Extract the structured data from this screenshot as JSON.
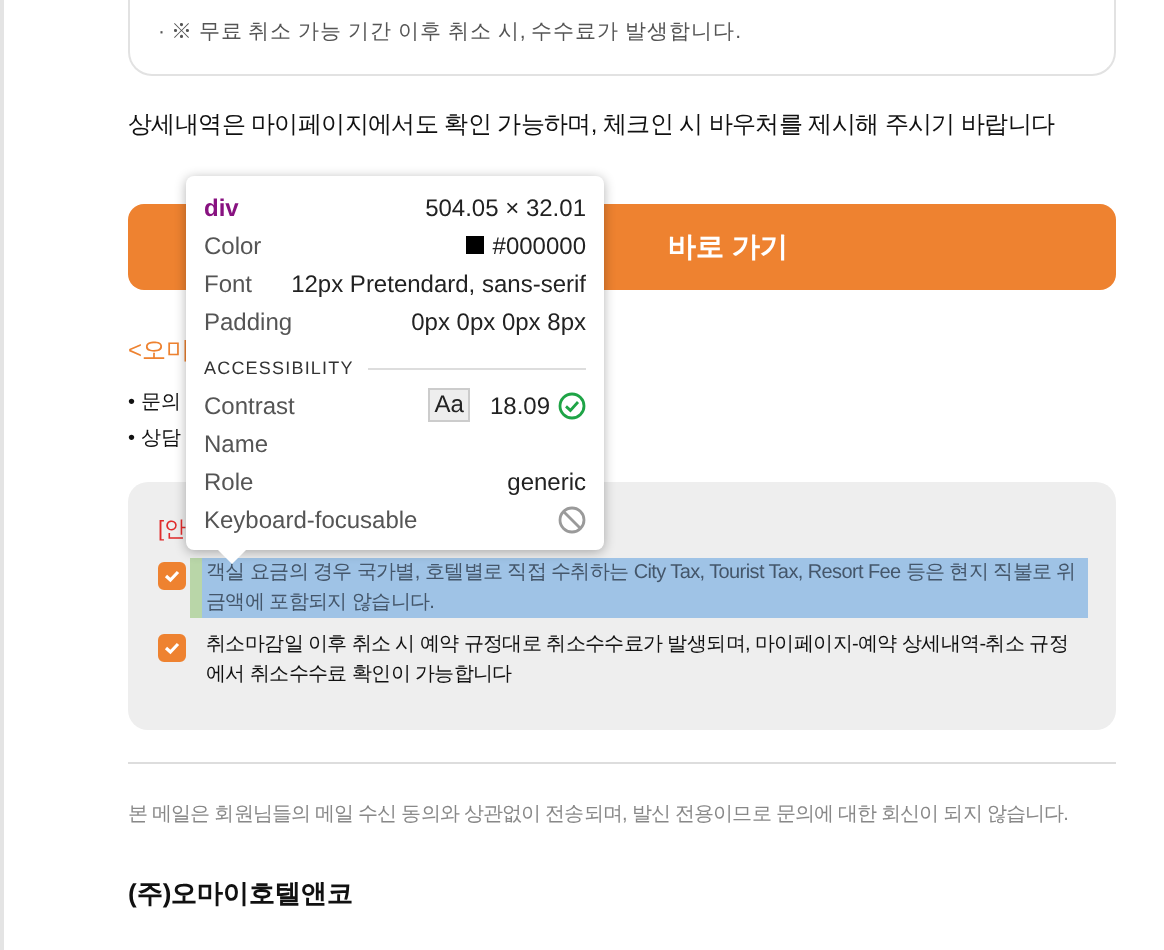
{
  "notice_card": {
    "bullets": [
      "· ※ 무료 취소 가능 기간 이후 취소 시, 수수료가 발생합니다."
    ]
  },
  "notice_text": "상세내역은 마이페이지에서도 확인 가능하며, 체크인 시 바우처를 제시해 주시기 바랍니다",
  "primary_button": {
    "label": "바로 가기"
  },
  "contact_link": "<오미",
  "contact_lines": [
    "• 문의",
    "• 상담"
  ],
  "notice_box": {
    "heading": "[안",
    "items": [
      {
        "checked": true,
        "highlighted": true,
        "text": "객실 요금의 경우 국가별, 호텔별로 직접 수취하는 City Tax, Tourist Tax, Resort Fee 등은 현지 직불로 위 금액에 포함되지 않습니다."
      },
      {
        "checked": true,
        "highlighted": false,
        "text": "취소마감일 이후 취소 시 예약 규정대로 취소수수료가 발생되며, 마이페이지-예약 상세내역-취소 규정에서 취소수수료 확인이 가능합니다"
      }
    ]
  },
  "footer_note": "본 메일은 회원님들의 메일 수신 동의와 상관없이 전송되며, 발신 전용이므로 문의에 대한 회신이 되지 않습니다.",
  "company": "(주)오마이호텔앤코",
  "inspector_tooltip": {
    "tag": "div",
    "size": "504.05 × 32.01",
    "properties": [
      {
        "label": "Color",
        "kind": "color",
        "value": "#000000"
      },
      {
        "label": "Font",
        "kind": "text",
        "value": "12px Pretendard, sans-serif"
      },
      {
        "label": "Padding",
        "kind": "text",
        "value": "0px 0px 0px 8px"
      }
    ],
    "section": "ACCESSIBILITY",
    "accessibility": [
      {
        "label": "Contrast",
        "kind": "contrast",
        "badge": "Aa",
        "value": "18.09"
      },
      {
        "label": "Name",
        "kind": "empty"
      },
      {
        "label": "Role",
        "kind": "text",
        "value": "generic"
      },
      {
        "label": "Keyboard-focusable",
        "kind": "blocked"
      }
    ]
  }
}
